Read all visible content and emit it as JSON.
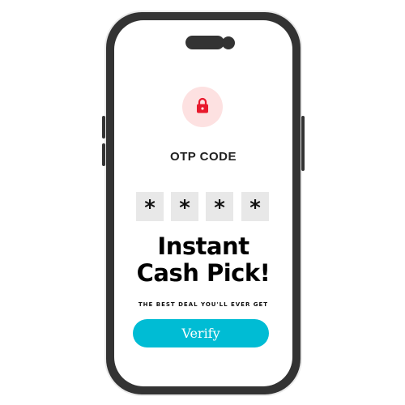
{
  "otp": {
    "title": "OTP CODE",
    "digits": [
      "*",
      "*",
      "*",
      "*"
    ]
  },
  "promo": {
    "headline_line1": "Instant",
    "headline_line2": "Cash Pick!",
    "tagline": "THE BEST DEAL YOU'LL EVER GET"
  },
  "actions": {
    "verify_label": "Verify"
  },
  "icons": {
    "lock": "lock-icon"
  },
  "colors": {
    "accent": "#00bcd4",
    "lock_red": "#e8192c",
    "lock_bg": "#fde1e1",
    "phone_frame": "#333333"
  }
}
